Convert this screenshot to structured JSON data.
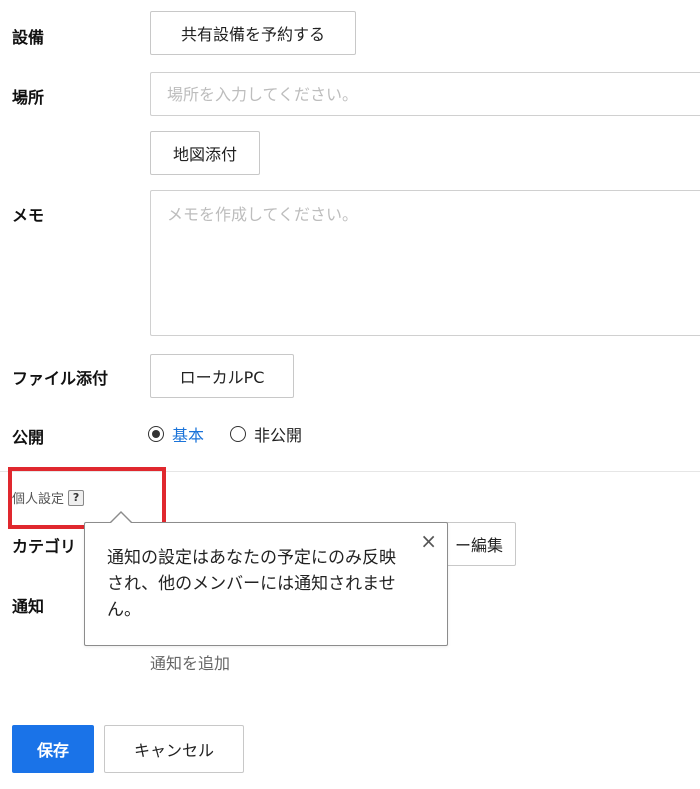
{
  "form": {
    "facility": {
      "label": "設備",
      "button": "共有設備を予約する"
    },
    "location": {
      "label": "場所",
      "placeholder": "場所を入力してください。",
      "map_button": "地図添付"
    },
    "memo": {
      "label": "メモ",
      "placeholder": "メモを作成してください。"
    },
    "attachment": {
      "label": "ファイル添付",
      "button": "ローカルPC"
    },
    "visibility": {
      "label": "公開",
      "options": [
        {
          "label": "基本",
          "selected": true
        },
        {
          "label": "非公開",
          "selected": false
        }
      ]
    },
    "personal": {
      "section_title": "個人設定",
      "help_icon": "?",
      "category_label": "カテゴリ",
      "category_edit_button": "ー編集",
      "notify_label": "通知",
      "add_notification": "通知を追加"
    },
    "tooltip": {
      "text": "通知の設定はあなたの予定にのみ反映され、他のメンバーには通知されません。",
      "close": "×"
    },
    "actions": {
      "save": "保存",
      "cancel": "キャンセル"
    }
  },
  "colors": {
    "accent": "#1a73e8",
    "selected_text": "#1a73d9",
    "highlight": "#e0282e"
  }
}
